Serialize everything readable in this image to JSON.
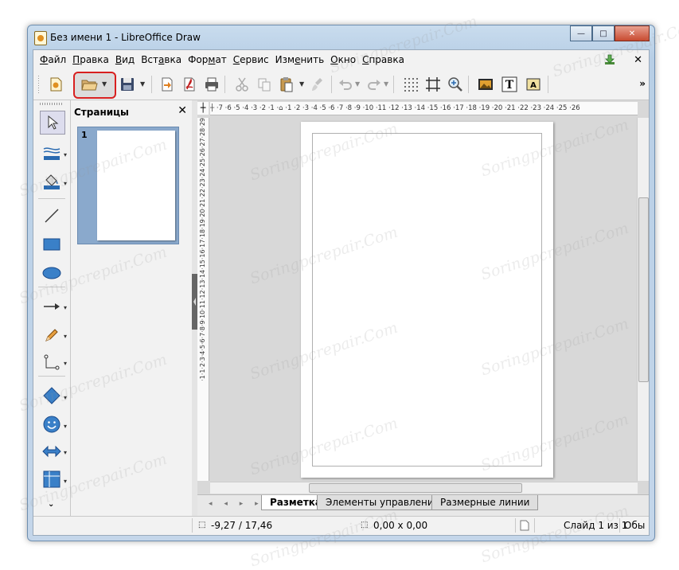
{
  "window": {
    "title": "Без имени 1 - LibreOffice Draw",
    "controls": {
      "minimize": "—",
      "maximize": "□",
      "close": "✕"
    }
  },
  "menubar": {
    "items": [
      {
        "u": "Ф",
        "rest": "айл"
      },
      {
        "u": "П",
        "rest": "равка"
      },
      {
        "u": "В",
        "rest": "ид"
      },
      {
        "u": "",
        "pre": "Вст",
        "mid": "а",
        "rest": "вка"
      },
      {
        "u": "",
        "pre": "Фор",
        "mid": "м",
        "rest": "ат"
      },
      {
        "u": "С",
        "rest": "ервис"
      },
      {
        "u": "",
        "pre": "Изм",
        "mid": "е",
        "rest": "нить"
      },
      {
        "u": "О",
        "rest": "кно"
      },
      {
        "u": "С",
        "rest": "правка"
      }
    ],
    "menu_labels": [
      "Файл",
      "Правка",
      "Вид",
      "Вставка",
      "Формат",
      "Сервис",
      "Изменить",
      "Окно",
      "Справка"
    ],
    "close_doc": "✕"
  },
  "toolbar": {
    "overflow": "»"
  },
  "pages_panel": {
    "title": "Страницы",
    "close": "✕",
    "page_number": "1"
  },
  "ruler": {
    "h_text": "┼ ·7 ·6 ·5 ·4 ·3 ·2 ·1 ·⌂ ·1 ·2 ·3 ·4 ·5 ·6 ·7 ·8 ·9 ·10 ·11 ·12 ·13 ·14 ·15 ·16 ·17 ·18 ·19 ·20 ·21 ·22 ·23 ·24 ·25 ·26",
    "v_text": "·1·1·2·3·4·5·6·7·8·9·10·11·12·13·14·15·16·17·18·19·20·21·22·23·24·25·26·27·28·29"
  },
  "tabs": {
    "items": [
      "Разметка",
      "Элементы управления",
      "Размерные линии"
    ],
    "active": 0,
    "nav": "◂ ◂ ▸ ▸"
  },
  "statusbar": {
    "position": "-9,27 / 17,46",
    "size": "0,00 x 0,00",
    "slide": "Слайд 1 из 1",
    "extra": "Обы"
  },
  "watermark": "Soringpcrepair.Com",
  "colors": {
    "highlight": "#d82020",
    "title_gradient": "#c9dcee",
    "thumb_selected": "#8aa9cc"
  }
}
